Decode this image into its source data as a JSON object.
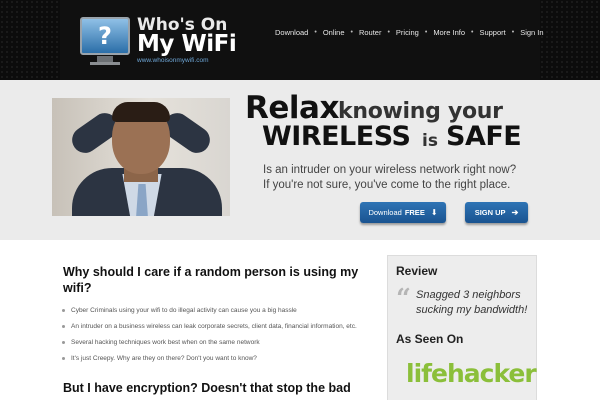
{
  "header": {
    "logo": {
      "monitor_icon": "question-mark-monitor-icon",
      "line1": "Who's On",
      "line2": "My WiFi",
      "url": "www.whoisonmywifi.com"
    },
    "nav": [
      {
        "label": "Download"
      },
      {
        "label": "Online"
      },
      {
        "label": "Router"
      },
      {
        "label": "Pricing"
      },
      {
        "label": "More Info"
      },
      {
        "label": "Support"
      },
      {
        "label": "Sign In"
      }
    ],
    "nav_separator": "•"
  },
  "hero": {
    "headline": {
      "relax": "Relax",
      "knowing": "knowing your",
      "wireless": "WIRELESS",
      "is": "is",
      "safe": "SAFE"
    },
    "subtext_line1": "Is an intruder on your wireless network right now?",
    "subtext_line2": "If you're not sure, you've come to the right place.",
    "download_button": {
      "label": "Download",
      "emphasis": "FREE",
      "icon": "down-arrow-icon"
    },
    "signup_button": {
      "label": "SIGN UP",
      "icon": "right-arrow-icon"
    }
  },
  "main": {
    "heading1": "Why should I care if a random person is using my wifi?",
    "bullets": [
      "Cyber Criminals using your wifi to do illegal activity can cause you a big hassle",
      "An intruder on a business wireless can leak corporate secrets, client data, financial information, etc.",
      "Several hacking techniques work best when on the same network",
      "It's just Creepy. Why are they on there? Don't you want to know?"
    ],
    "heading2": "But I have encryption? Doesn't that stop the bad"
  },
  "sidebar": {
    "review_title": "Review",
    "quote_mark": "“",
    "quote": "Snagged 3 neighbors sucking my bandwidth!",
    "seen_title": "As Seen On",
    "press_logo": "lifehacker"
  },
  "colors": {
    "header_bg": "#0c0c0c",
    "hero_bg": "#ebebeb",
    "button_blue": "#1f5f9f",
    "link_blue": "#6ea6d6",
    "lifehacker_green": "#8bbf3a"
  }
}
